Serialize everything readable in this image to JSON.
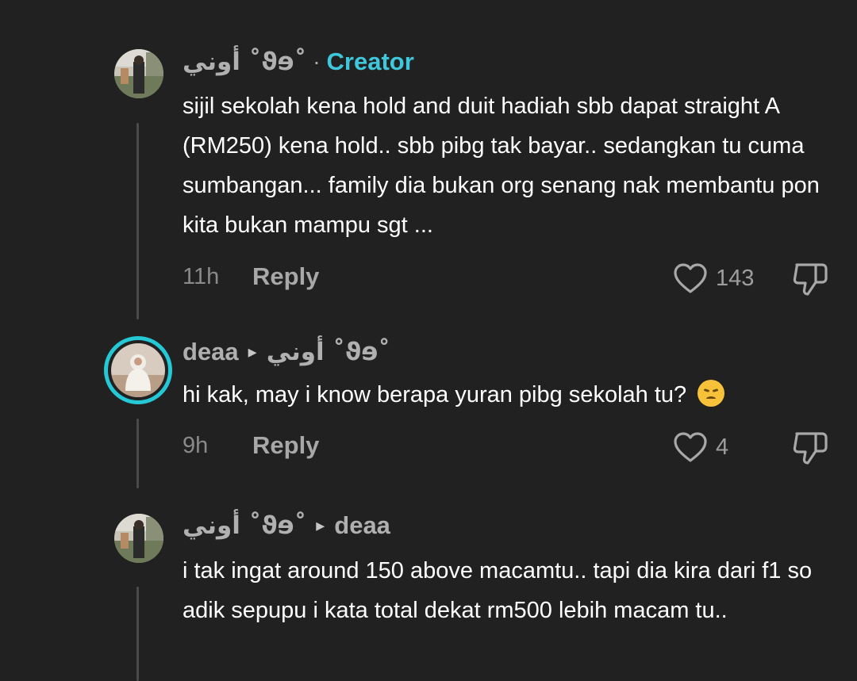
{
  "comments": [
    {
      "author": "أوني ˚ϑɘ˚",
      "badge_sep": "·",
      "badge": "Creator",
      "text": "sijil sekolah kena hold and duit hadiah sbb dapat straight A (RM250) kena hold.. sbb pibg tak bayar.. sedangkan tu cuma sumbangan... family dia bukan org senang nak membantu pon kita bukan mampu sgt ...",
      "time": "11h",
      "reply_label": "Reply",
      "likes": "143"
    },
    {
      "author": "deaa",
      "arrow": "▸",
      "reply_to": "أوني ˚ϑɘ˚",
      "text": "hi kak, may i know berapa yuran pibg sekolah tu?",
      "emoji": "disappointed-face",
      "time": "9h",
      "reply_label": "Reply",
      "likes": "4"
    },
    {
      "author": "أوني ˚ϑɘ˚",
      "arrow": "▸",
      "reply_to": "deaa",
      "text": "i tak ingat around 150 above macamtu.. tapi dia kira dari f1 so adik sepupu i kata total dekat rm500 lebih macam tu.."
    }
  ],
  "icons": {
    "like": "heart-outline-icon",
    "dislike": "thumbs-down-icon",
    "arrow": "play-triangle-icon"
  },
  "colors": {
    "background": "#212121",
    "creator_badge": "#3fc8dc",
    "story_ring": "#25c9d6"
  }
}
